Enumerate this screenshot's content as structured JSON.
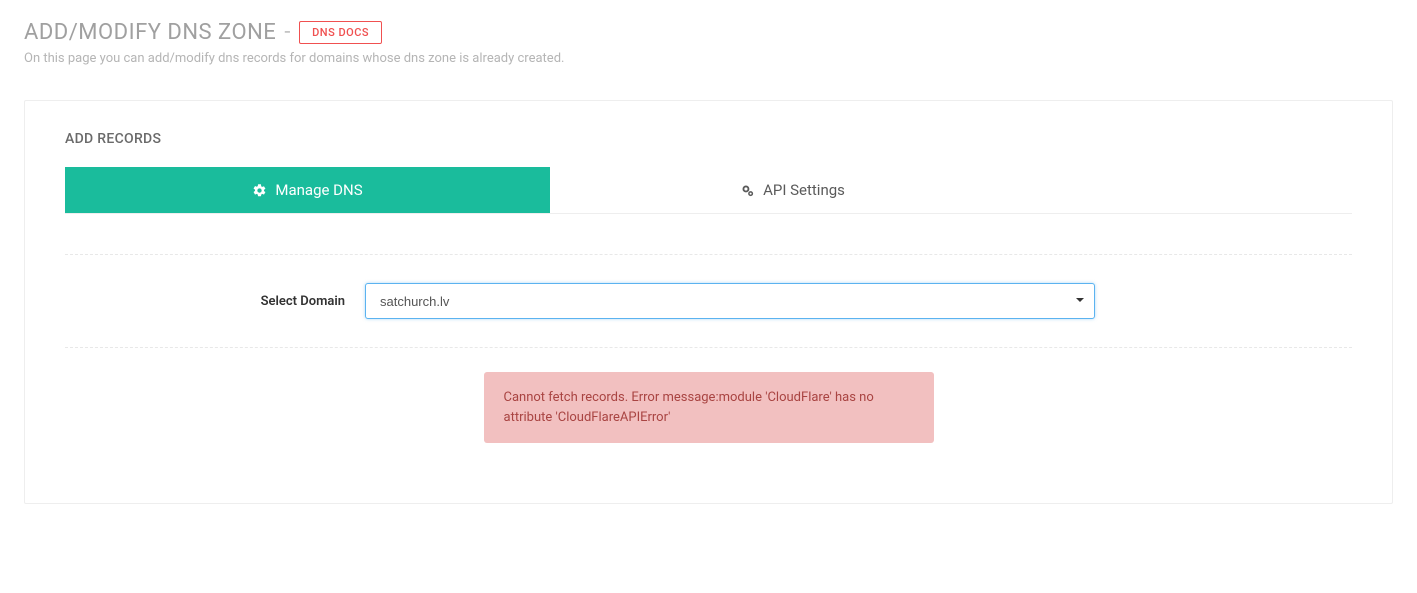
{
  "header": {
    "title": "ADD/MODIFY DNS ZONE",
    "separator": "-",
    "docs_badge": "DNS DOCS",
    "subtitle": "On this page you can add/modify dns records for domains whose dns zone is already created."
  },
  "section": {
    "title": "ADD RECORDS"
  },
  "tabs": {
    "manage": "Manage DNS",
    "api": "API Settings"
  },
  "form": {
    "domain_label": "Select Domain",
    "domain_value": "satchurch.lv"
  },
  "alert": {
    "message": "Cannot fetch records. Error message:module 'CloudFlare' has no attribute 'CloudFlareAPIError'"
  }
}
